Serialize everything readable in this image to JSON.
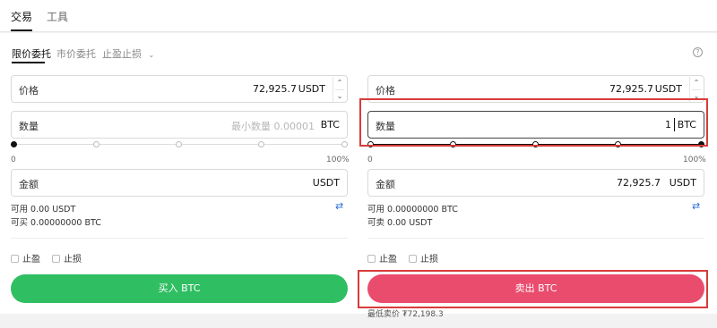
{
  "tabs": {
    "trade_label": "交易",
    "tools_label": "工具"
  },
  "order_types": {
    "limit_label": "限价委托",
    "market_label": "市价委托",
    "tpsl_label": "止盈止损"
  },
  "buy": {
    "price_label": "价格",
    "price_value": "72,925.7",
    "price_unit": "USDT",
    "qty_label": "数量",
    "qty_placeholder": "最小数量 0.00001",
    "qty_unit": "BTC",
    "pct_min": "0",
    "pct_max": "100%",
    "amount_label": "金额",
    "amount_unit": "USDT",
    "available": "可用 0.00 USDT",
    "can_buy": "可买 0.00000000 BTC",
    "tp_label": "止盈",
    "sl_label": "止损",
    "button_label": "买入 BTC"
  },
  "sell": {
    "price_label": "价格",
    "price_value": "72,925.7",
    "price_unit": "USDT",
    "qty_label": "数量",
    "qty_value": "1",
    "qty_unit": "BTC",
    "pct_min": "0",
    "pct_max": "100%",
    "amount_label": "金额",
    "amount_value": "72,925.7",
    "amount_unit": "USDT",
    "available": "可用 0.00000000 BTC",
    "can_sell": "可卖 0.00 USDT",
    "tp_label": "止盈",
    "sl_label": "止损",
    "button_label": "卖出 BTC",
    "lowest_price": "最低卖价 ₮72,198.3"
  },
  "colors": {
    "buy": "#2fbe62",
    "sell": "#ea4c6e",
    "highlight": "#d93b3b"
  }
}
